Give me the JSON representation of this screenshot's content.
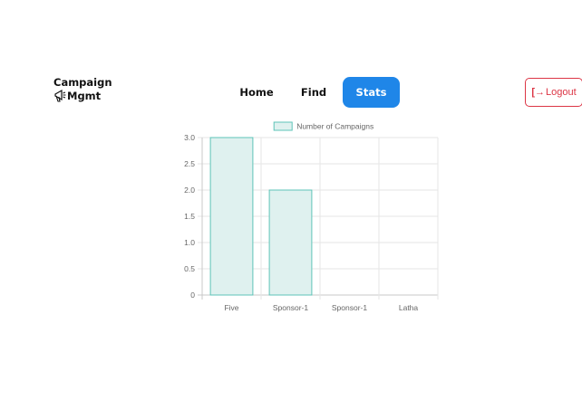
{
  "brand": {
    "line1": "Campaign",
    "line2": "Mgmt",
    "icon": "megaphone-icon"
  },
  "nav": {
    "home": "Home",
    "find": "Find",
    "stats": "Stats"
  },
  "logout": {
    "icon": "sign-out-icon",
    "label": "Logout"
  },
  "colors": {
    "accent": "#1f86e8",
    "danger": "#dc3545",
    "bar_fill": "#dff1ef",
    "bar_border": "#5ec4b8"
  },
  "chart_data": {
    "type": "bar",
    "categories": [
      "Five",
      "Sponsor-1",
      "Sponsor-1",
      "Latha"
    ],
    "series": [
      {
        "name": "Number of Campaigns",
        "values": [
          3,
          2,
          0,
          0
        ]
      }
    ],
    "yticks": [
      "0",
      "0.5",
      "1.0",
      "1.5",
      "2.0",
      "2.5",
      "3.0"
    ],
    "ylim": [
      0,
      3
    ],
    "grid": true,
    "legend": "top"
  }
}
